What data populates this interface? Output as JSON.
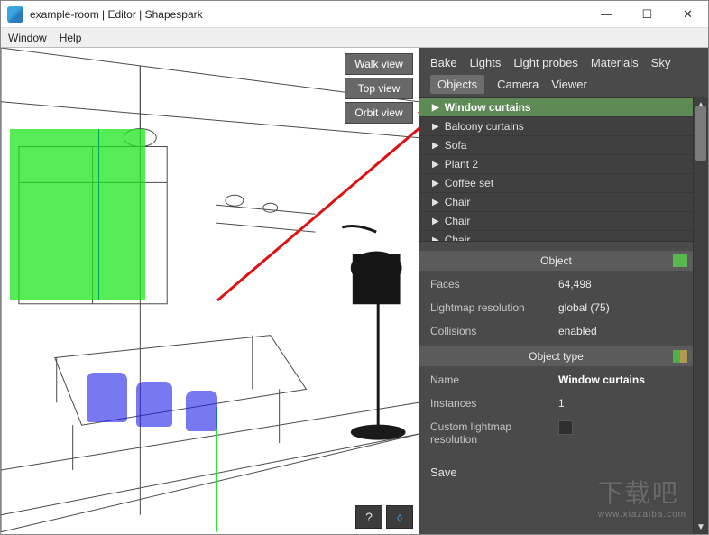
{
  "window": {
    "title": "example-room | Editor | Shapespark"
  },
  "menu": {
    "window": "Window",
    "help": "Help"
  },
  "view_buttons": {
    "walk": "Walk view",
    "top": "Top view",
    "orbit": "Orbit view"
  },
  "viewport_bottom": {
    "help": "?",
    "cube": "⬨"
  },
  "panel": {
    "tabs_row1": {
      "bake": "Bake",
      "lights": "Lights",
      "probes": "Light probes",
      "materials": "Materials",
      "sky": "Sky"
    },
    "tabs_row2": {
      "objects": "Objects",
      "camera": "Camera",
      "viewer": "Viewer"
    },
    "tree": [
      "Window curtains",
      "Balcony curtains",
      "Sofa",
      "Plant 2",
      "Coffee set",
      "Chair",
      "Chair",
      "Chair"
    ],
    "section_object": "Object",
    "object_props": {
      "faces_label": "Faces",
      "faces_value": "64,498",
      "lightmap_label": "Lightmap resolution",
      "lightmap_value": "global (75)",
      "collisions_label": "Collisions",
      "collisions_value": "enabled"
    },
    "section_type": "Object type",
    "type_props": {
      "name_label": "Name",
      "name_value": "Window curtains",
      "instances_label": "Instances",
      "instances_value": "1",
      "custom_lm_label": "Custom lightmap resolution"
    },
    "save": "Save"
  },
  "watermark": {
    "big": "下载吧",
    "small": "www.xiazaiba.com"
  }
}
